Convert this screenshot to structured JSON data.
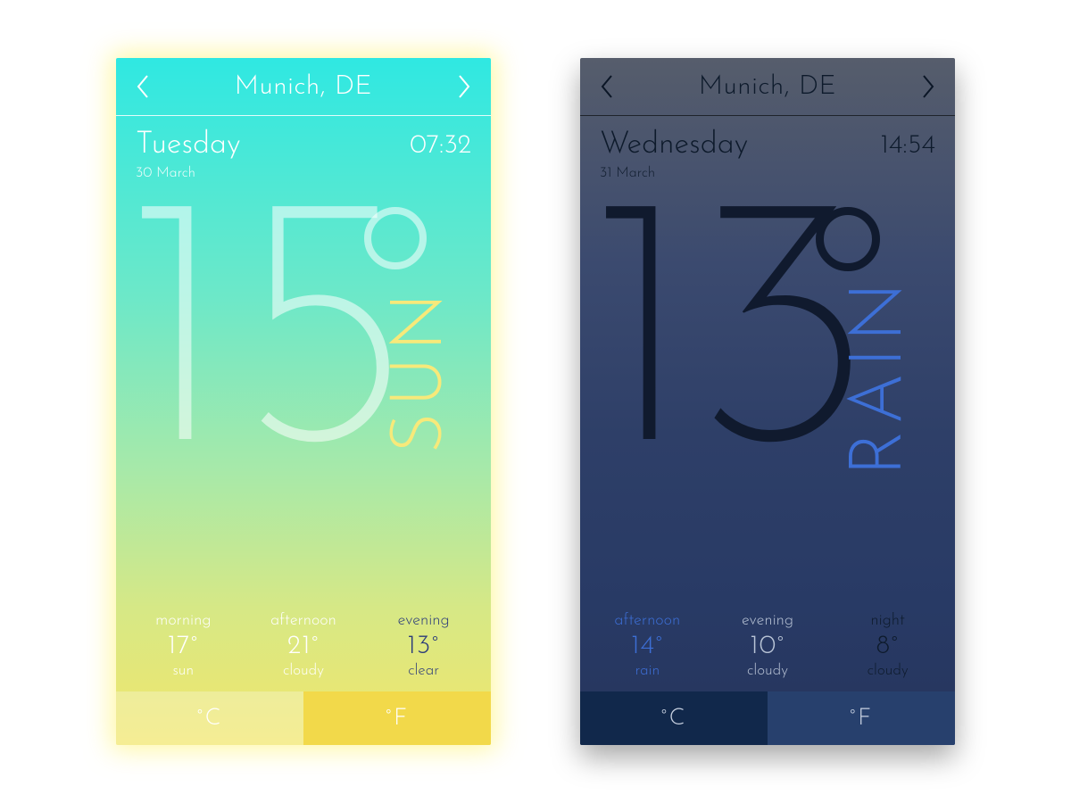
{
  "cards": [
    {
      "theme": "light",
      "location": "Munich, DE",
      "day": "Tuesday",
      "date": "30 March",
      "time": "07:32",
      "temp": "15",
      "condition": "SUN",
      "forecast": [
        {
          "part": "morning",
          "temp": "17°",
          "desc": "sun",
          "accent": false
        },
        {
          "part": "afternoon",
          "temp": "21°",
          "desc": "cloudy",
          "accent": false
        },
        {
          "part": "evening",
          "temp": "13°",
          "desc": "clear",
          "accent": true
        }
      ],
      "units": {
        "c": "°C",
        "f": "°F",
        "active": "c"
      }
    },
    {
      "theme": "dark",
      "location": "Munich, DE",
      "day": "Wednesday",
      "date": "31 March",
      "time": "14:54",
      "temp": "13",
      "condition": "RAIN",
      "forecast": [
        {
          "part": "afternoon",
          "temp": "14°",
          "desc": "rain",
          "accent": true
        },
        {
          "part": "evening",
          "temp": "10°",
          "desc": "cloudy",
          "accent": false
        },
        {
          "part": "night",
          "temp": "8°",
          "desc": "cloudy",
          "dim": true
        }
      ],
      "units": {
        "c": "°C",
        "f": "°F",
        "active": "c"
      }
    }
  ]
}
